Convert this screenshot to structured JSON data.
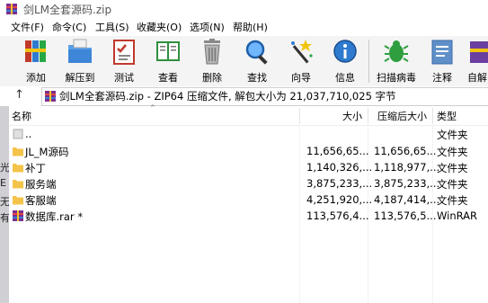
{
  "window": {
    "title": "剑LM全套源码.zip"
  },
  "menu": [
    "文件(F)",
    "命令(C)",
    "工具(S)",
    "收藏夹(O)",
    "选项(N)",
    "帮助(H)"
  ],
  "toolbar": [
    {
      "label": "添加",
      "icon": "add-books-icon"
    },
    {
      "label": "解压到",
      "icon": "extract-folder-icon"
    },
    {
      "label": "测试",
      "icon": "test-checklist-icon"
    },
    {
      "label": "查看",
      "icon": "view-book-icon"
    },
    {
      "label": "删除",
      "icon": "trash-icon"
    },
    {
      "label": "查找",
      "icon": "magnifier-icon"
    },
    {
      "label": "向导",
      "icon": "wizard-wand-icon"
    },
    {
      "label": "信息",
      "icon": "info-icon"
    },
    {
      "label": "扫描病毒",
      "icon": "virus-scan-icon"
    },
    {
      "label": "注释",
      "icon": "comment-icon"
    },
    {
      "label": "自解",
      "icon": "sfx-icon"
    }
  ],
  "address": {
    "text": "剑LM全套源码.zip - ZIP64 压缩文件, 解包大小为 21,037,710,025 字节"
  },
  "columns": {
    "name": "名称",
    "size": "大小",
    "packed": "压缩后大小",
    "type": "类型"
  },
  "rows": [
    {
      "name": "..",
      "size": "",
      "packed": "",
      "type": "文件夹",
      "icon": "parent-folder-icon"
    },
    {
      "name": "JL_M源码",
      "size": "11,656,65...",
      "packed": "11,656,65...",
      "type": "文件夹",
      "icon": "folder-icon"
    },
    {
      "name": "补丁",
      "size": "1,140,326,...",
      "packed": "1,118,977,...",
      "type": "文件夹",
      "icon": "folder-icon"
    },
    {
      "name": "服务端",
      "size": "3,875,233,...",
      "packed": "3,875,233,...",
      "type": "文件夹",
      "icon": "folder-icon"
    },
    {
      "name": "客服端",
      "size": "4,251,920,...",
      "packed": "4,187,414,...",
      "type": "文件夹",
      "icon": "folder-icon"
    },
    {
      "name": "数据库.rar *",
      "size": "113,576,4...",
      "packed": "113,576,5...",
      "type": "WinRAR",
      "icon": "rar-archive-icon"
    }
  ],
  "left_strip": [
    "光",
    "E",
    "无",
    "有"
  ],
  "colors": {
    "folder": "#f4c44a",
    "accent": "#1e6fd0",
    "toolbar_bg": "#f4f4f4"
  }
}
